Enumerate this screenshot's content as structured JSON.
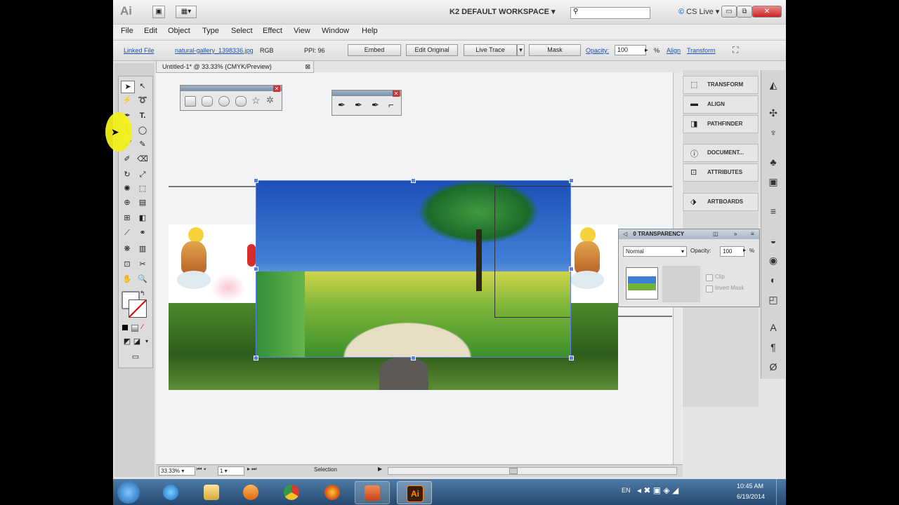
{
  "app": {
    "logo": "Ai",
    "workspace": "K2 DEFAULT WORKSPACE",
    "cs_live": "CS Live"
  },
  "menu": [
    "File",
    "Edit",
    "Object",
    "Type",
    "Select",
    "Effect",
    "View",
    "Window",
    "Help"
  ],
  "control_bar": {
    "linked_file": "Linked File",
    "file_name": "natural-gallery_1398336.jpg",
    "color_mode": "RGB",
    "ppi_label": "PPI: 96",
    "embed": "Embed",
    "edit_original": "Edit Original",
    "live_trace": "Live Trace",
    "mask": "Mask",
    "opacity_label": "Opacity:",
    "opacity_value": "100",
    "percent": "%",
    "align": "Align",
    "transform": "Transform"
  },
  "document": {
    "tab_title": "Untitled-1* @ 33.33% (CMYK/Preview)",
    "zoom": "33.33%",
    "page": "1",
    "status": "Selection"
  },
  "right_panels": [
    {
      "label": "TRANSFORM",
      "icon": "transform-icon"
    },
    {
      "label": "ALIGN",
      "icon": "align-icon"
    },
    {
      "label": "PATHFINDER",
      "icon": "pathfinder-icon"
    },
    {
      "label": "DOCUMENT...",
      "icon": "document-info-icon"
    },
    {
      "label": "ATTRIBUTES",
      "icon": "attributes-icon"
    },
    {
      "label": "ARTBOARDS",
      "icon": "artboards-icon"
    }
  ],
  "transparency": {
    "tab": "0 TRANSPARENCY",
    "mode": "Normal",
    "opacity_label": "Opacity:",
    "opacity_value": "100",
    "percent": "%",
    "clip": "Clip",
    "invert_mask": "Invert Mask"
  },
  "taskbar": {
    "lang": "EN",
    "time": "10:45 AM",
    "date": "6/19/2014",
    "ai_label": "Ai"
  },
  "colors": {
    "accent": "#1b4fb3",
    "taskbar": "#26496f",
    "highlight": "#f2ef1a"
  }
}
